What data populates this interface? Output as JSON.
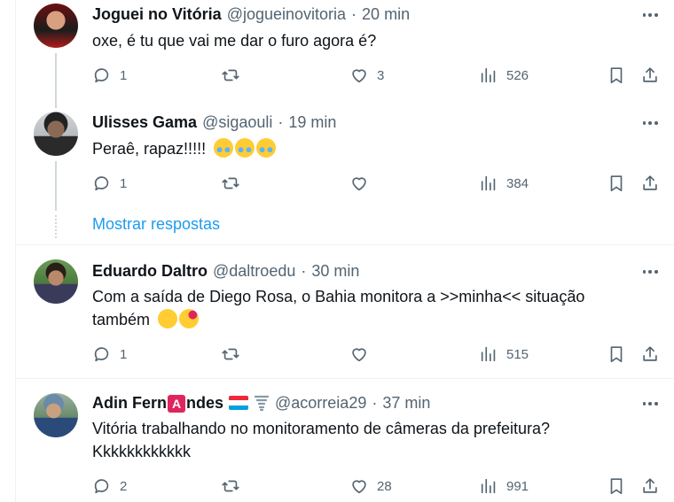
{
  "tweets": [
    {
      "name": "Joguei no Vitória",
      "handle": "@jogueinovitoria",
      "time": "20 min",
      "text": "oxe, é tu que vai me dar o furo agora é?",
      "replies": "1",
      "retweets": "",
      "likes": "3",
      "views": "526",
      "avatar_colors": [
        "#8b1a1a",
        "#1a1a1a"
      ]
    },
    {
      "name": "Ulisses Gama",
      "handle": "@sigaouli",
      "time": "19 min",
      "text": "Peraê, rapaz!!!!!",
      "replies": "1",
      "retweets": "",
      "likes": "",
      "views": "384",
      "avatar_colors": [
        "#c9cdd2",
        "#3a3a3a"
      ]
    },
    {
      "name": "Eduardo Daltro",
      "handle": "@daltroedu",
      "time": "30 min",
      "text_line1": "Com a saída de Diego Rosa, o Bahia monitora a >>minha<< situação",
      "text_line2": "também",
      "replies": "1",
      "retweets": "",
      "likes": "",
      "views": "515",
      "avatar_colors": [
        "#5c8a4a",
        "#3b5a2c"
      ]
    },
    {
      "name_part1": "Adin Fern",
      "name_badge": "A",
      "name_part2": "ndes",
      "handle": "@acorreia29",
      "time": "37 min",
      "text_line1": "Vitória trabalhando no monitoramento de câmeras da prefeitura?",
      "text_line2": "Kkkkkkkkkkkk",
      "replies": "2",
      "retweets": "",
      "likes": "28",
      "views": "991",
      "avatar_colors": [
        "#7a9a6a",
        "#4a6a8a"
      ]
    }
  ],
  "show_replies_label": "Mostrar respostas",
  "icons": {
    "reply": "reply-icon",
    "retweet": "retweet-icon",
    "like": "heart-icon",
    "views": "views-icon",
    "bookmark": "bookmark-icon",
    "share": "share-icon",
    "more": "more-icon"
  },
  "colors": {
    "text": "#0f1419",
    "secondary": "#536471",
    "link": "#1d9bf0",
    "border": "#eff3f4"
  }
}
